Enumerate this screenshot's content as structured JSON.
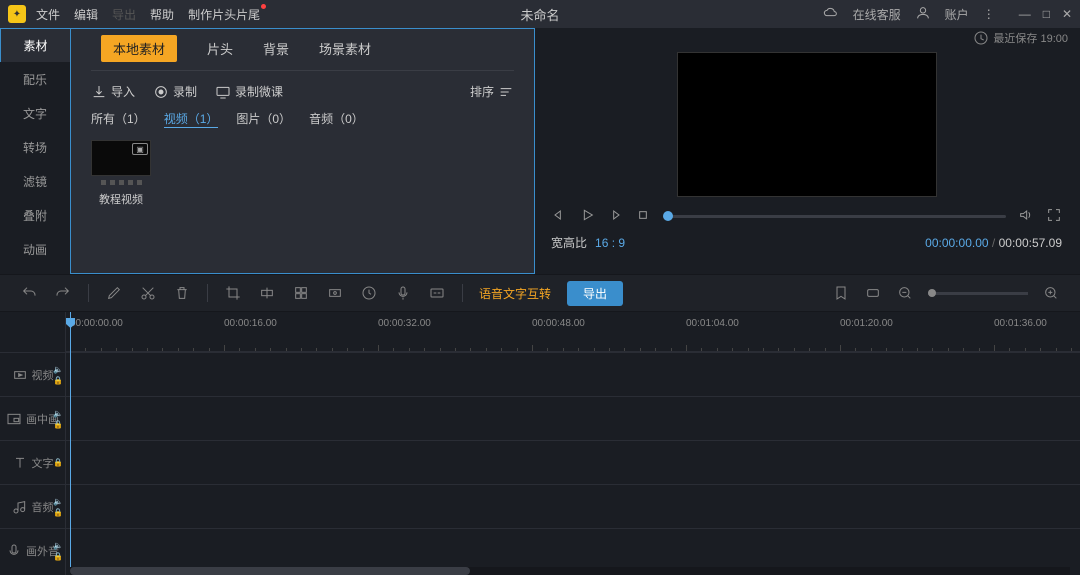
{
  "titlebar": {
    "menu": {
      "file": "文件",
      "edit": "编辑",
      "export": "导出",
      "help": "帮助",
      "intro_outro": "制作片头片尾"
    },
    "title": "未命名",
    "support": "在线客服",
    "account": "账户",
    "last_save": "最近保存 19:00"
  },
  "side_tabs": [
    "素材",
    "配乐",
    "文字",
    "转场",
    "滤镜",
    "叠附",
    "动画"
  ],
  "material": {
    "tabs": [
      "本地素材",
      "片头",
      "背景",
      "场景素材"
    ],
    "actions": {
      "import": "导入",
      "record": "录制",
      "record_course": "录制微课",
      "sort": "排序"
    },
    "filters": {
      "all": "所有（1）",
      "video": "视频（1）",
      "image": "图片（0）",
      "audio": "音频（0）"
    },
    "thumb_label": "教程视频"
  },
  "preview": {
    "ratio_label": "宽高比",
    "ratio_value": "16 : 9",
    "current_time": "00:00:00.00",
    "total_time": "00:00:57.09"
  },
  "toolbar": {
    "speech": "语音文字互转",
    "export": "导出"
  },
  "timeline": {
    "marks": [
      "00:00:00.00",
      "00:00:16.00",
      "00:00:32.00",
      "00:00:48.00",
      "00:01:04.00",
      "00:01:20.00",
      "00:01:36.00"
    ],
    "tracks": {
      "video": "视频",
      "pip": "画中画",
      "text": "文字",
      "audio": "音频",
      "voice": "画外音"
    }
  }
}
